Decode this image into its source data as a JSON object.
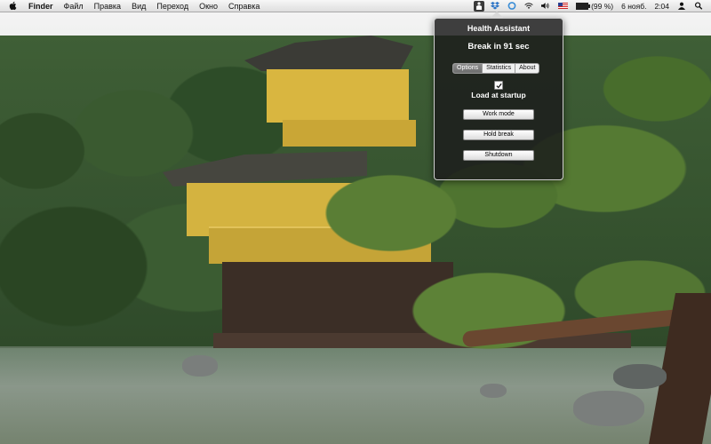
{
  "menubar": {
    "apple_icon": "apple-logo",
    "app_name": "Finder",
    "menus": [
      "Файл",
      "Правка",
      "Вид",
      "Переход",
      "Окно",
      "Справка"
    ],
    "tray": {
      "battery_text": "(99 %)",
      "battery_level_percent": 99,
      "date": "6 нояб.",
      "time": "2:04",
      "icons": [
        "health-assistant-icon",
        "dropbox-icon",
        "ring-icon",
        "wifi-icon",
        "volume-icon",
        "us-flag-icon",
        "battery-icon",
        "user-icon",
        "spotlight-icon"
      ]
    }
  },
  "health_assistant": {
    "title": "Health Assistant",
    "timer_text": "Break in 91 sec",
    "tabs": [
      {
        "label": "Options",
        "selected": true
      },
      {
        "label": "Statistics",
        "selected": false
      },
      {
        "label": "About",
        "selected": false
      }
    ],
    "load_at_startup": {
      "label": "Load at startup",
      "checked": true
    },
    "buttons": {
      "work_mode": "Work mode",
      "hold_break": "Hold break",
      "shutdown": "Shutdown"
    }
  },
  "colors": {
    "hud_background": "#1c1c1c",
    "menubar_background": "#e8e8e8"
  }
}
